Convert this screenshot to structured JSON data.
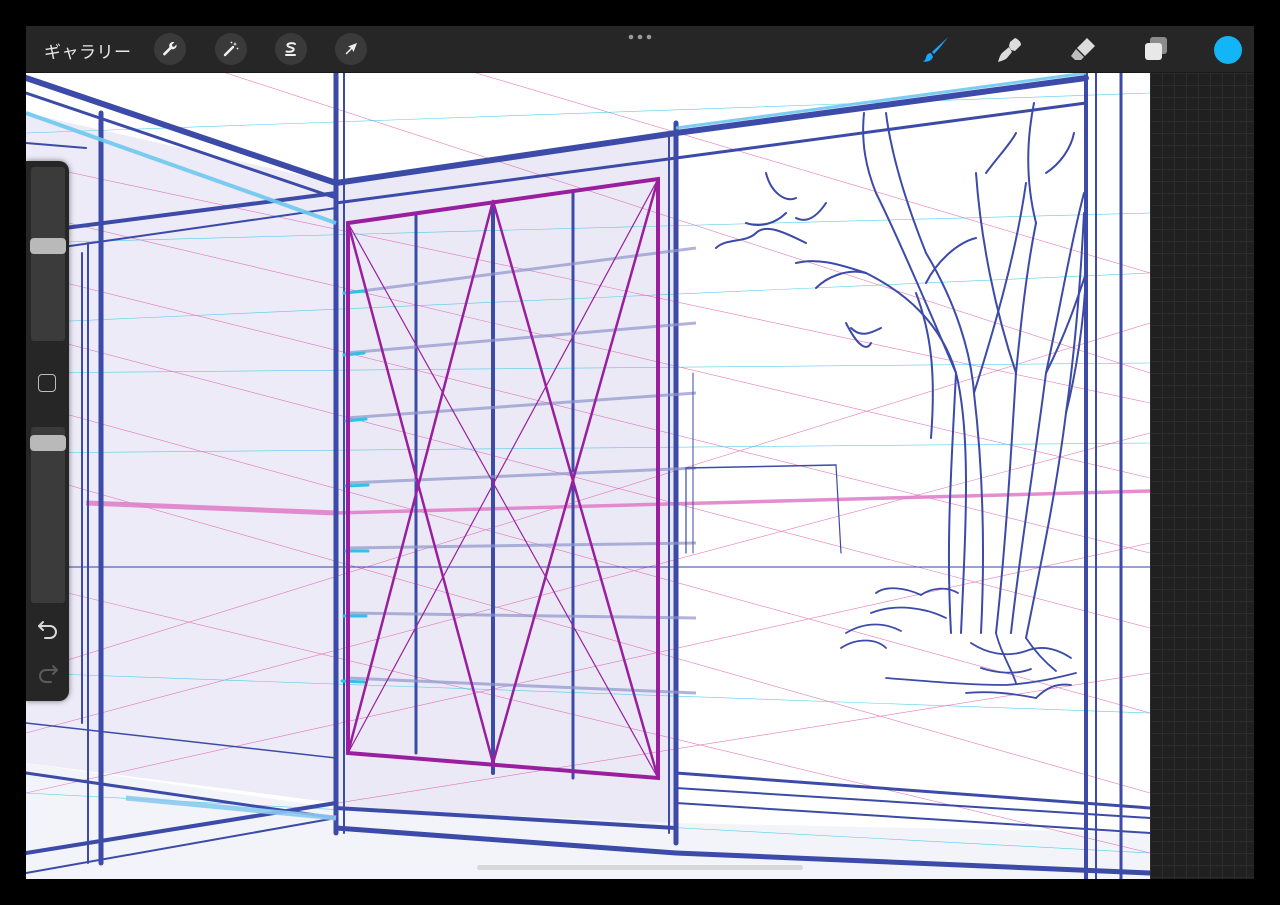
{
  "toolbar": {
    "gallery_label": "ギャラリー",
    "left_tools": [
      "wrench-icon",
      "magic-wand-icon",
      "selection-icon",
      "transform-arrow-icon"
    ],
    "right_tools": [
      "brush-icon",
      "smudge-icon",
      "eraser-icon",
      "layers-icon"
    ],
    "active_tool": "brush-icon",
    "current_color": "#12b5f5"
  },
  "sidebar": {
    "brush_size_level": 0.45,
    "opacity_level": 0.05,
    "controls": [
      "modify-square-icon",
      "undo-icon",
      "redo-icon"
    ]
  },
  "colors": {
    "stroke_blue": "#3c4aa8",
    "guide_magenta": "#9a1f9e",
    "guide_cyan": "#2ec3e6",
    "guide_pink": "#e05aa8"
  }
}
